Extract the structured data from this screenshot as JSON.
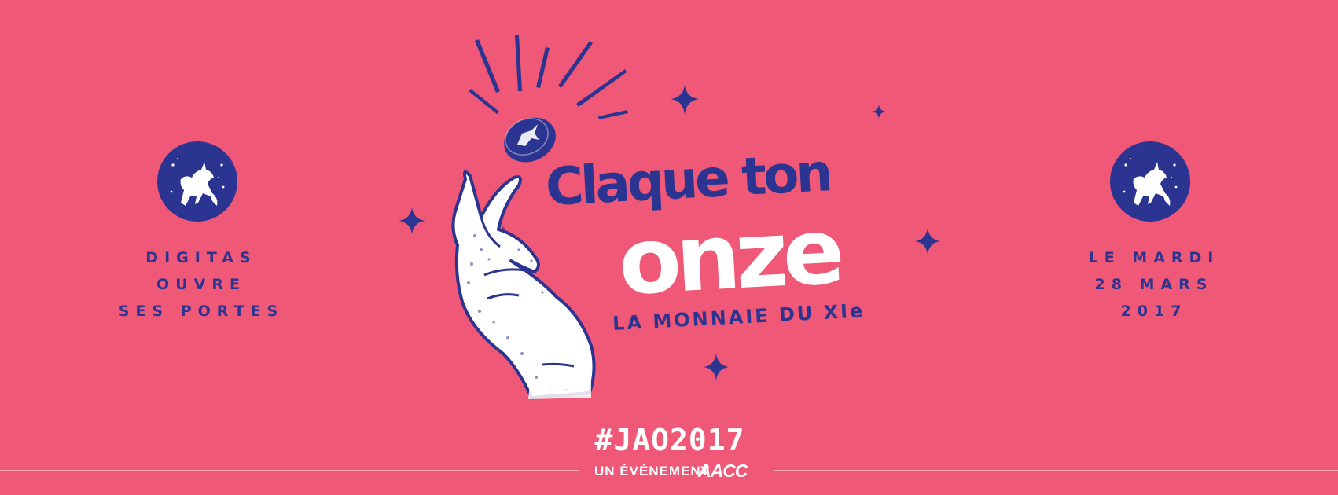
{
  "banner": {
    "background_color": "#EF5877",
    "accent_color": "#2B3490",
    "highlight_color": "#FFFFFF"
  },
  "left_block": {
    "icon": "unicorn-icon",
    "lines": [
      "DIGITAS",
      "OUVRE",
      "SES PORTES"
    ]
  },
  "right_block": {
    "icon": "unicorn-icon",
    "lines": [
      "LE MARDI",
      "28 MARS",
      "2017"
    ]
  },
  "center": {
    "headline_line1": "Claque ton",
    "headline_line2": "onze",
    "subtitle": "LA MONNAIE DU XIe",
    "illustration": "snapping-hand-with-coin"
  },
  "footer": {
    "hashtag": "#JAO2017",
    "event_label": "UN ÉVÉNEMENT",
    "logo_text": "AACC"
  }
}
